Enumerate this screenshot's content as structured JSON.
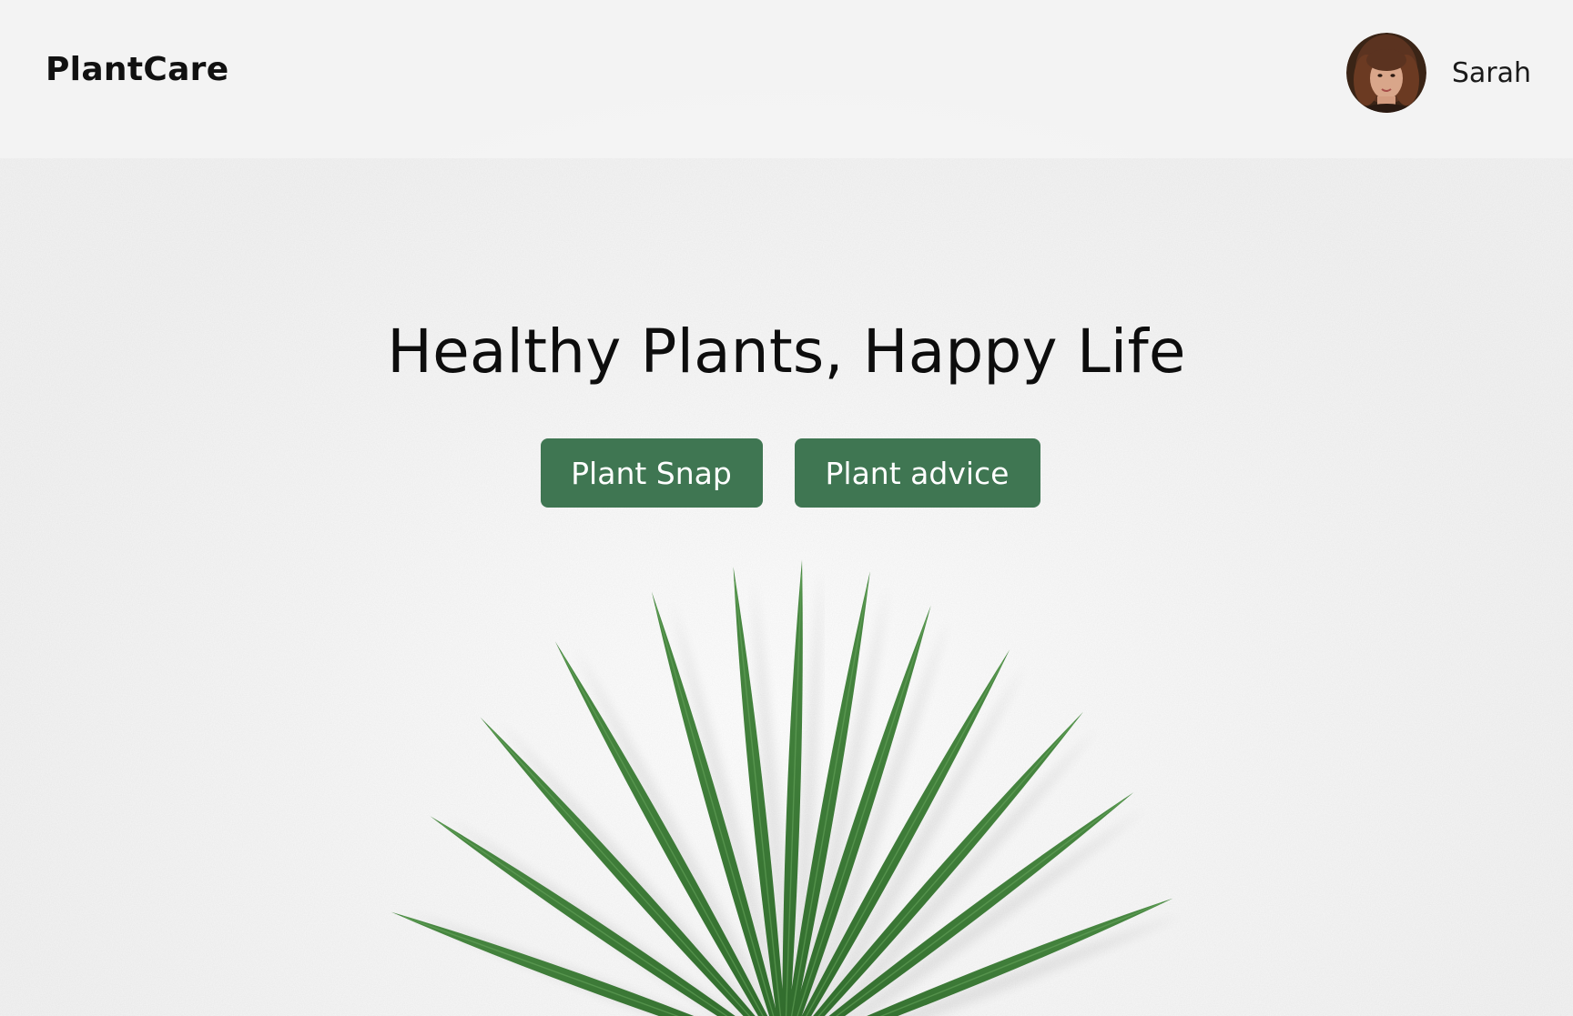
{
  "header": {
    "brand": "PlantCare",
    "user": {
      "name": "Sarah",
      "avatar_icon": "avatar-photo"
    }
  },
  "hero": {
    "headline": "Healthy Plants, Happy Life",
    "buttons": [
      {
        "label": "Plant Snap"
      },
      {
        "label": "Plant advice"
      }
    ]
  },
  "colors": {
    "accent": "#3f7652",
    "background": "#f8f8f8",
    "text": "#111111",
    "leaf": "#3d7a38"
  }
}
